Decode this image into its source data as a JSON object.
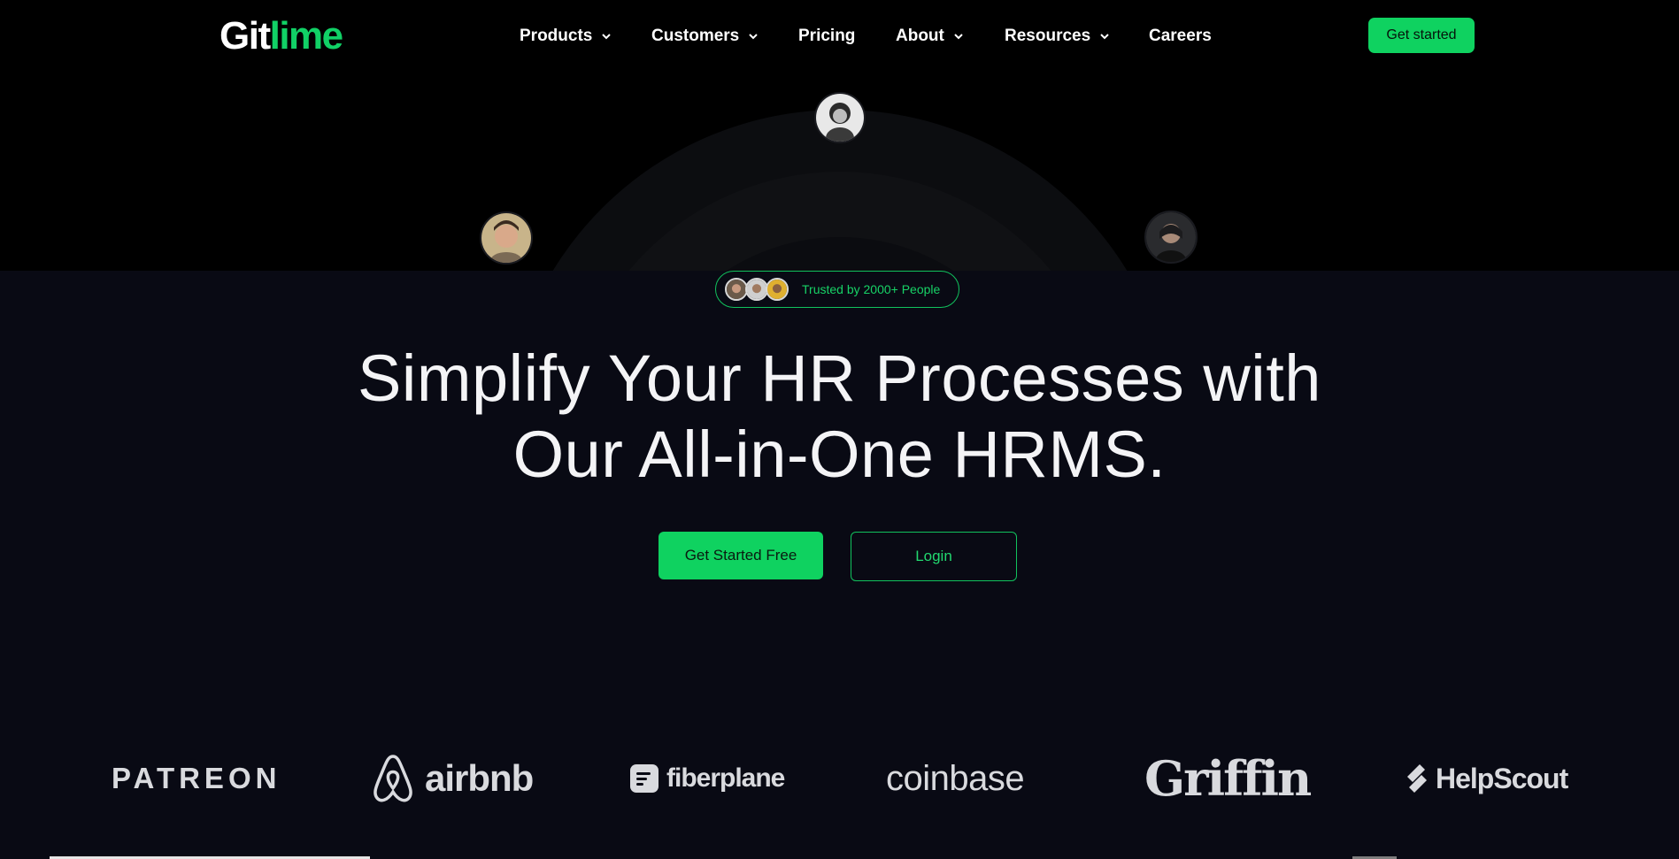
{
  "brand": {
    "logo_part1": "Git",
    "logo_part2": "lime",
    "accent": "#0fd260"
  },
  "nav": {
    "items": [
      {
        "label": "Products",
        "has_dropdown": true
      },
      {
        "label": "Customers",
        "has_dropdown": true
      },
      {
        "label": "Pricing",
        "has_dropdown": false
      },
      {
        "label": "About",
        "has_dropdown": true
      },
      {
        "label": "Resources",
        "has_dropdown": true
      },
      {
        "label": "Careers",
        "has_dropdown": false
      }
    ],
    "cta_label": "Get started"
  },
  "trust": {
    "text": "Trusted by 2000+ People"
  },
  "hero": {
    "headline_line1": "Simplify Your HR Processes with",
    "headline_line2": "Our All-in-One HRMS."
  },
  "cta": {
    "primary_label": "Get Started Free",
    "secondary_label": "Login"
  },
  "logos": {
    "patreon": "PATREON",
    "airbnb": "airbnb",
    "fiberplane": "fiberplane",
    "coinbase": "coinbase",
    "griffin": "Griffin",
    "helpscout": "HelpScout"
  }
}
